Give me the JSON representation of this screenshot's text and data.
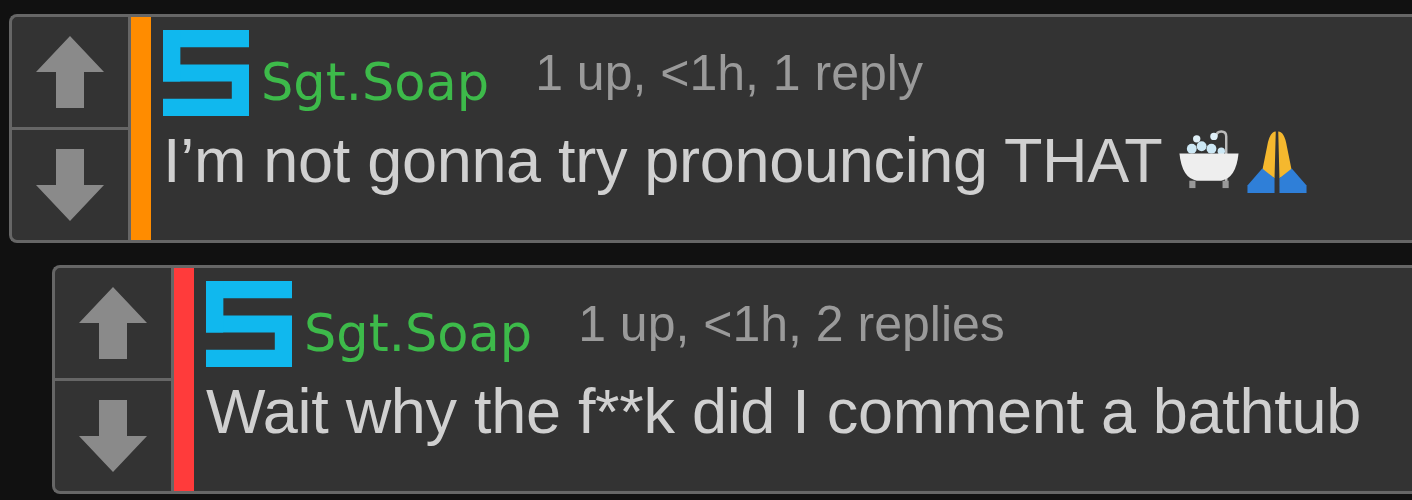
{
  "comments": [
    {
      "color": "#ff8c00",
      "username": "Sgt.Soap",
      "meta": "1 up, <1h, 1 reply",
      "text": "I’m not gonna try pronouncing THAT",
      "trailing_icons": [
        {
          "kind": "bathtub"
        },
        {
          "kind": "praying-hands"
        }
      ],
      "children": [
        {
          "color": "#ff3b3b",
          "username": "Sgt.Soap",
          "meta": "1 up, <1h, 2 replies",
          "text": "Wait why the f**k did I comment a bathtub"
        }
      ]
    }
  ]
}
